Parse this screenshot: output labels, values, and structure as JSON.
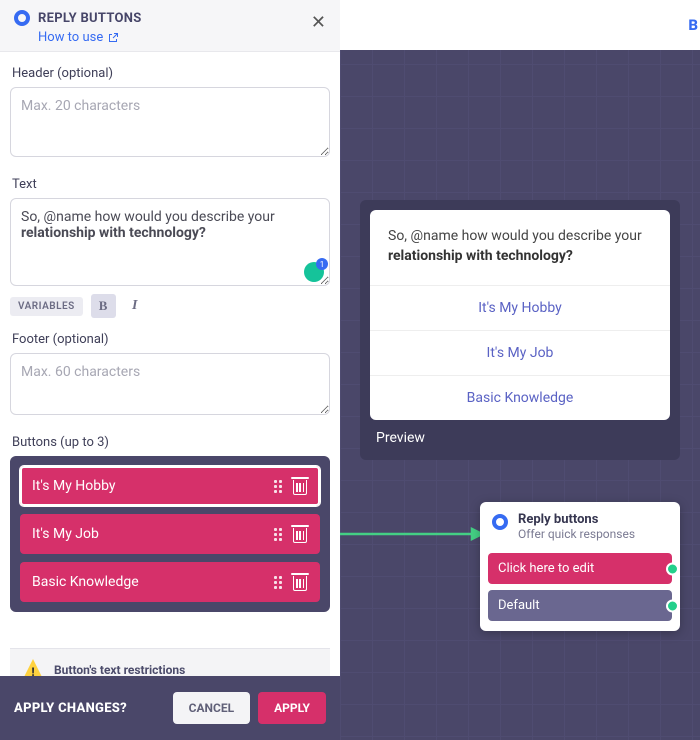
{
  "panel": {
    "title": "REPLY BUTTONS",
    "howto": "How to use",
    "header_label": "Header (optional)",
    "header_placeholder": "Max. 20 characters",
    "text_label": "Text",
    "text_prefix": "So, @name how would you describe your ",
    "text_bold": "relationship with technology?",
    "variables_chip": "VARIABLES",
    "bold_chip": "B",
    "italic_chip": "I",
    "footer_label": "Footer (optional)",
    "footer_placeholder": "Max. 60 characters",
    "buttons_label": "Buttons (up to 3)",
    "buttons": [
      {
        "label": "It's My Hobby",
        "selected": true
      },
      {
        "label": "It's My Job",
        "selected": false
      },
      {
        "label": "Basic Knowledge",
        "selected": false
      }
    ],
    "warning": "Button's text restrictions",
    "apply_q": "APPLY CHANGES?",
    "cancel": "CANCEL",
    "apply": "APPLY"
  },
  "canvas": {
    "top_right_letter": "B",
    "preview_text_prefix": "So, @name how would you describe your ",
    "preview_text_bold": "relationship with technology?",
    "preview_options": [
      "It's My Hobby",
      "It's My Job",
      "Basic Knowledge"
    ],
    "preview_label": "Preview",
    "node": {
      "title": "Reply buttons",
      "subtitle": "Offer quick responses",
      "pill_edit": "Click here to edit",
      "pill_default": "Default"
    }
  }
}
